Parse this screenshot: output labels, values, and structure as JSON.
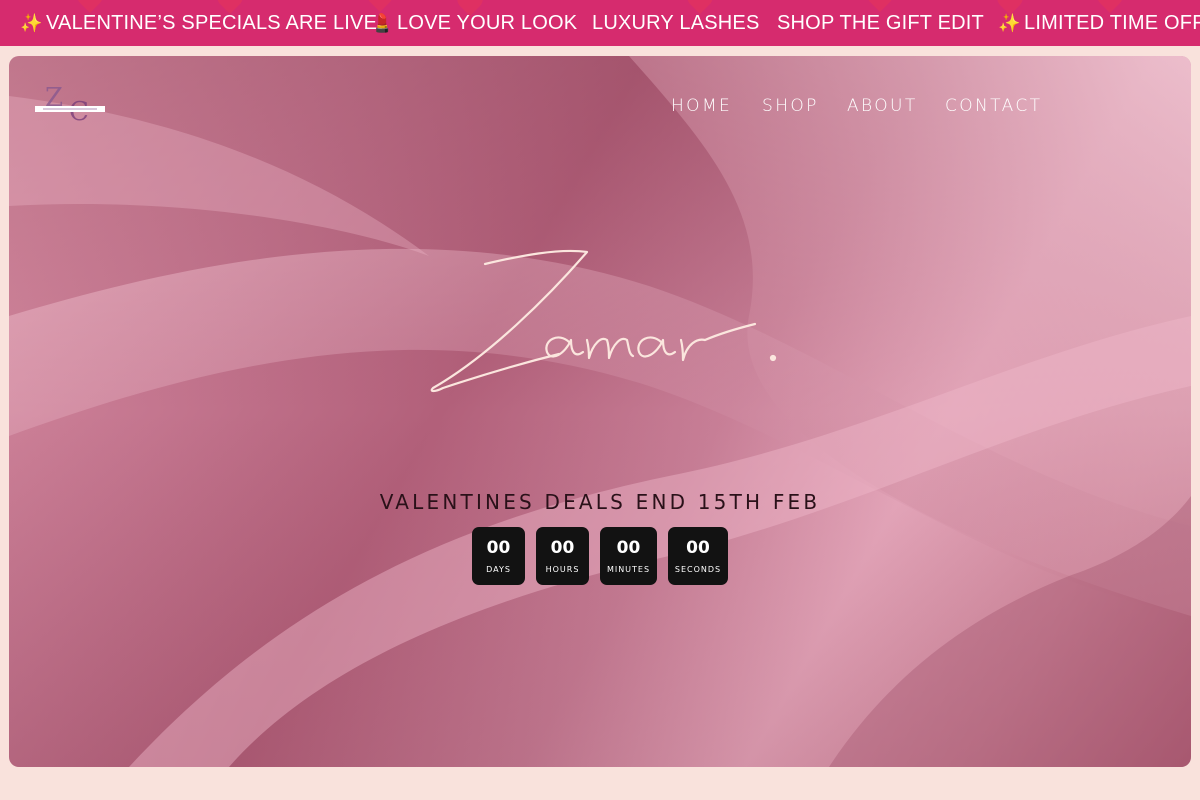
{
  "announcement": {
    "items": [
      {
        "emoji": "✨",
        "text": "VALENTINE’S SPECIALS ARE LIVE!"
      },
      {
        "emoji": "💄",
        "text": "LOVE YOUR LOOK"
      },
      {
        "emoji": "",
        "text": "LUXURY LASHES"
      },
      {
        "emoji": "",
        "text": "SHOP THE GIFT EDIT"
      },
      {
        "emoji": "✨",
        "text": "LIMITED TIME OFFE"
      }
    ],
    "background": "#d62b6e"
  },
  "header": {
    "logo_text": "ZC",
    "nav": [
      {
        "label": "HOME"
      },
      {
        "label": "SHOP"
      },
      {
        "label": "ABOUT"
      },
      {
        "label": "CONTACT"
      }
    ]
  },
  "hero": {
    "brand_script": "Zamar.",
    "deal_heading": "VALENTINES DEALS END 15TH FEB",
    "countdown": [
      {
        "value": "00",
        "label": "DAYS"
      },
      {
        "value": "00",
        "label": "HOURS"
      },
      {
        "value": "00",
        "label": "MINUTES"
      },
      {
        "value": "00",
        "label": "SECONDS"
      }
    ]
  },
  "colors": {
    "page_background": "#f9e2dc",
    "countdown_box": "#121212",
    "nav_text": "#ffffff"
  }
}
